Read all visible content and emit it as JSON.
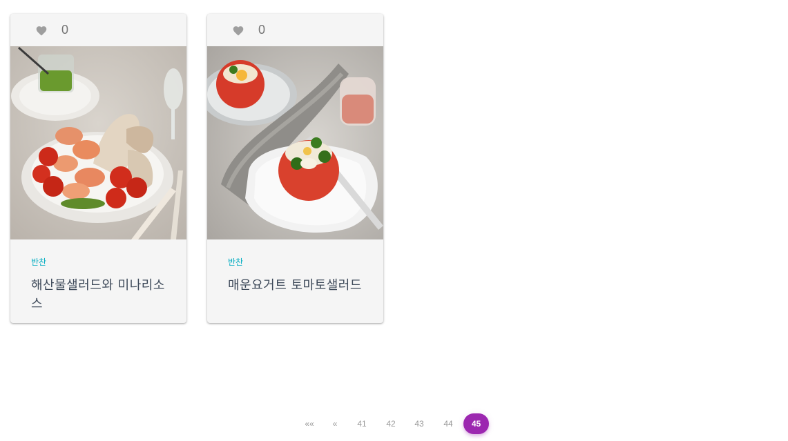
{
  "cards": [
    {
      "likes": "0",
      "category": "반찬",
      "title": "해산물샐러드와 미나리소스",
      "image": "plate of grilled shrimp, cherry tomatoes, squid and mushroom with green minari sauce"
    },
    {
      "likes": "0",
      "category": "반찬",
      "title": "매운요거트 토마토샐러드",
      "image": "hollowed tomatoes filled with yogurt salad and broccoli on white plates with pink dressing"
    }
  ],
  "pagination": {
    "first": "««",
    "prev": "«",
    "pages": [
      "41",
      "42",
      "43",
      "44",
      "45"
    ],
    "active": "45"
  },
  "colors": {
    "accent": "#9c27b0",
    "category": "#00acc1",
    "card_bg": "#f5f5f5"
  },
  "icons": {
    "like": "heart-icon"
  }
}
